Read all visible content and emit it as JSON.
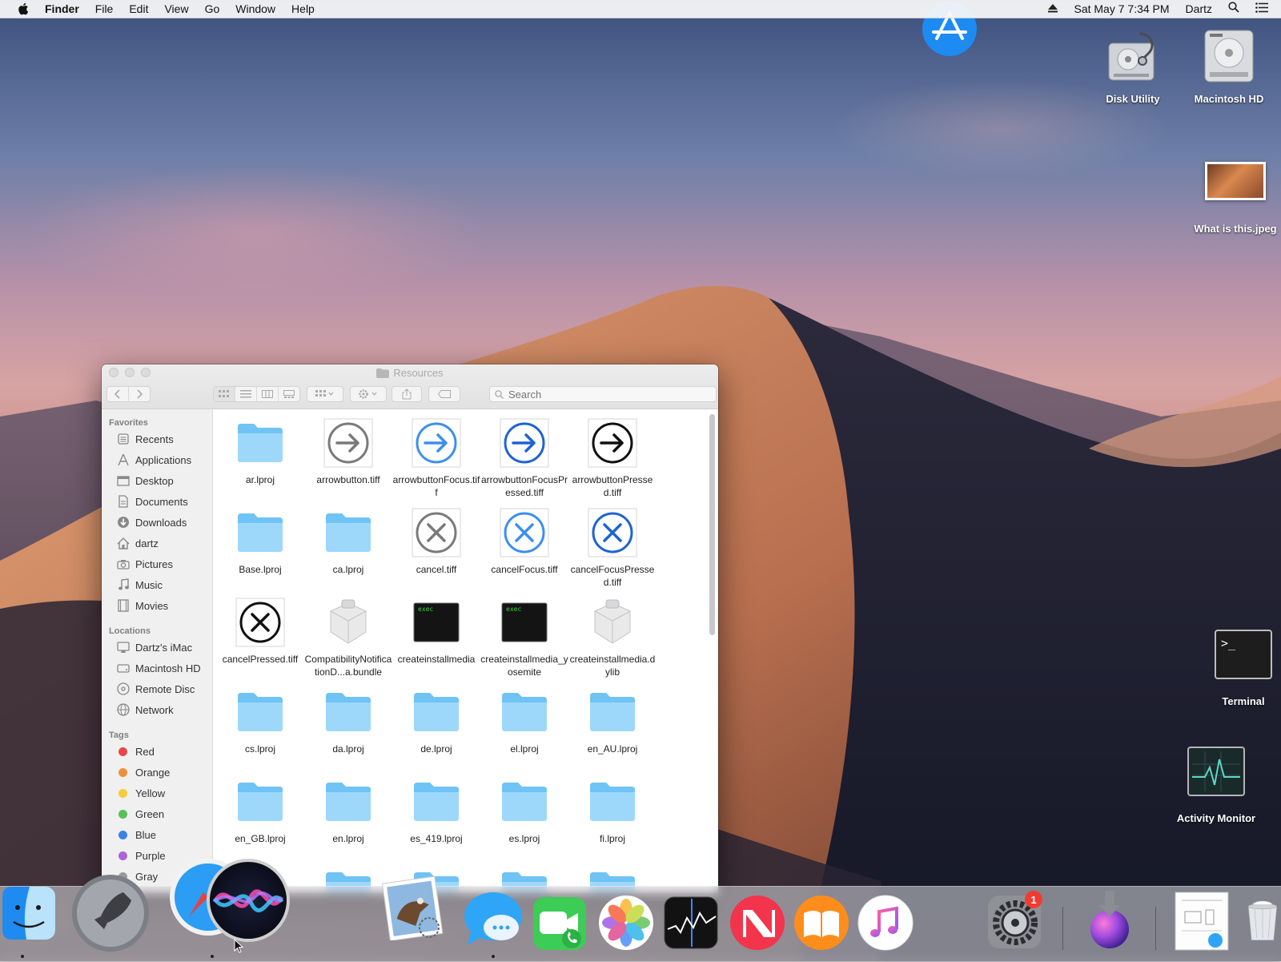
{
  "menubar": {
    "app_name": "Finder",
    "menus": [
      "File",
      "Edit",
      "View",
      "Go",
      "Window",
      "Help"
    ],
    "datetime": "Sat May 7  7:34 PM",
    "user": "Dartz"
  },
  "desktop_icons": {
    "disk_utility": "Disk Utility",
    "macintosh_hd": "Macintosh HD",
    "what_is_this": "What is this.jpeg",
    "terminal": "Terminal",
    "activity_monitor": "Activity Monitor",
    "terminal_prompt": ">_"
  },
  "finder": {
    "title": "Resources",
    "search_placeholder": "Search",
    "sidebar": {
      "favorites_header": "Favorites",
      "favorites": [
        "Recents",
        "Applications",
        "Desktop",
        "Documents",
        "Downloads",
        "dartz",
        "Pictures",
        "Music",
        "Movies"
      ],
      "locations_header": "Locations",
      "locations": [
        "Dartz's iMac",
        "Macintosh HD",
        "Remote Disc",
        "Network"
      ],
      "tags_header": "Tags",
      "tags": [
        {
          "label": "Red",
          "color": "#e8474c"
        },
        {
          "label": "Orange",
          "color": "#f0913a"
        },
        {
          "label": "Yellow",
          "color": "#f4cd3a"
        },
        {
          "label": "Green",
          "color": "#5ac05a"
        },
        {
          "label": "Blue",
          "color": "#3b82e8"
        },
        {
          "label": "Purple",
          "color": "#b062d6"
        },
        {
          "label": "Gray",
          "color": "#9a9a9a"
        }
      ]
    },
    "files": [
      {
        "name": "ar.lproj",
        "kind": "folder"
      },
      {
        "name": "arrowbutton.tiff",
        "kind": "arrow-gray"
      },
      {
        "name": "arrowbuttonFocus.tiff",
        "kind": "arrow-blue"
      },
      {
        "name": "arrowbuttonFocusPressed.tiff",
        "kind": "arrow-darkblue"
      },
      {
        "name": "arrowbuttonPressed.tiff",
        "kind": "arrow-black"
      },
      {
        "name": "Base.lproj",
        "kind": "folder"
      },
      {
        "name": "ca.lproj",
        "kind": "folder"
      },
      {
        "name": "cancel.tiff",
        "kind": "cancel-gray"
      },
      {
        "name": "cancelFocus.tiff",
        "kind": "cancel-blue"
      },
      {
        "name": "cancelFocusPressed.tiff",
        "kind": "cancel-darkblue"
      },
      {
        "name": "cancelPressed.tiff",
        "kind": "cancel-black"
      },
      {
        "name": "CompatibilityNotificationD...a.bundle",
        "kind": "bundle"
      },
      {
        "name": "createinstallmedia",
        "kind": "exec"
      },
      {
        "name": "createinstallmedia_yosemite",
        "kind": "exec"
      },
      {
        "name": "createinstallmedia.dylib",
        "kind": "bundle"
      },
      {
        "name": "cs.lproj",
        "kind": "folder"
      },
      {
        "name": "da.lproj",
        "kind": "folder"
      },
      {
        "name": "de.lproj",
        "kind": "folder"
      },
      {
        "name": "el.lproj",
        "kind": "folder"
      },
      {
        "name": "en_AU.lproj",
        "kind": "folder"
      },
      {
        "name": "en_GB.lproj",
        "kind": "folder"
      },
      {
        "name": "en.lproj",
        "kind": "folder"
      },
      {
        "name": "es_419.lproj",
        "kind": "folder"
      },
      {
        "name": "es.lproj",
        "kind": "folder"
      },
      {
        "name": "fi.lproj",
        "kind": "folder"
      },
      {
        "name": "",
        "kind": "folder"
      },
      {
        "name": "",
        "kind": "folder"
      },
      {
        "name": "",
        "kind": "folder"
      },
      {
        "name": "",
        "kind": "folder"
      },
      {
        "name": "",
        "kind": "folder"
      }
    ],
    "exec_label": "exec"
  },
  "dock": {
    "items": [
      "finder-icon",
      "launchpad-icon",
      "safari-icon",
      "siri-icon",
      "mail-icon",
      "messages-icon",
      "facetime-icon",
      "photos-icon",
      "stocks-icon",
      "news-icon",
      "books-icon",
      "music-icon",
      "app-store-icon",
      "system-preferences-icon",
      "installer-icon",
      "preview-icon",
      "trash-icon"
    ],
    "system_preferences_badge": "1"
  }
}
